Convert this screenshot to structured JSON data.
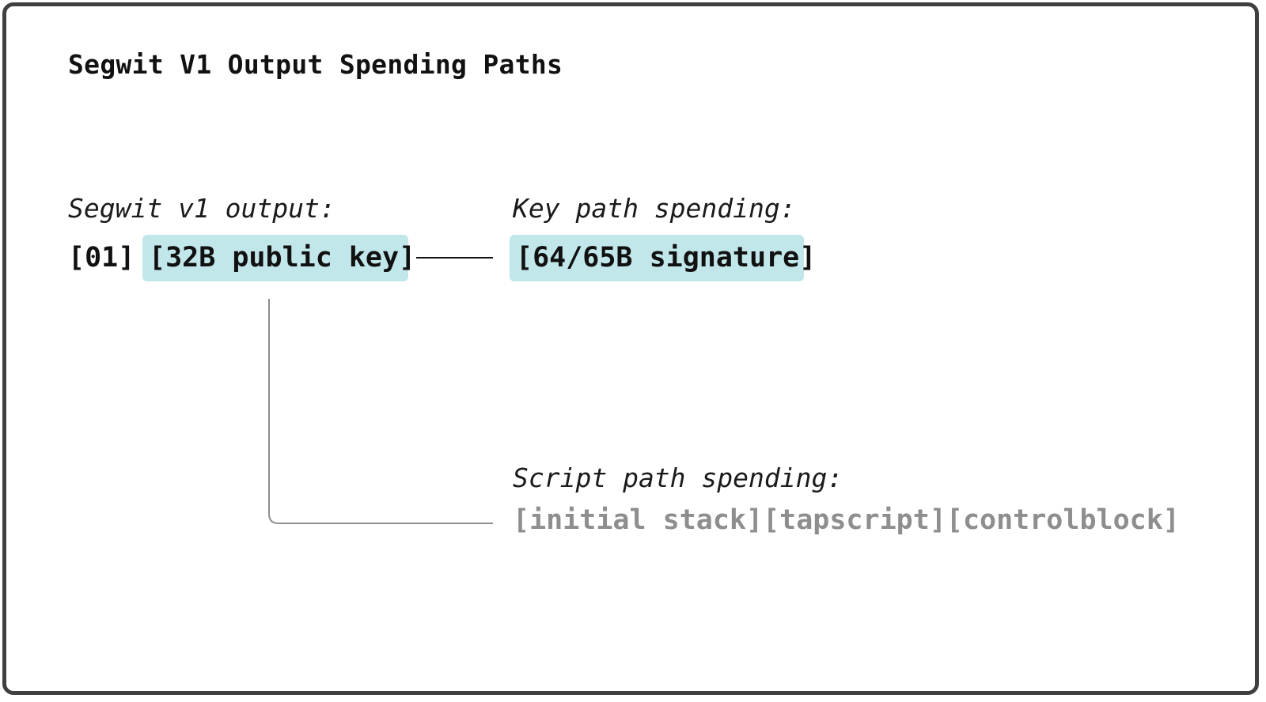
{
  "title": "Segwit V1 Output Spending Paths",
  "output": {
    "label": "Segwit v1 output:",
    "version": "[01]",
    "pubkey": "[32B public key]"
  },
  "key_path": {
    "label": "Key path spending:",
    "signature": "[64/65B signature]"
  },
  "script_path": {
    "label": "Script path spending:",
    "witness": "[initial stack][tapscript][controlblock]"
  },
  "colors": {
    "highlight": "#c2e7ea",
    "muted_text": "#8e8e8e",
    "connector_key": "#111111",
    "connector_script": "#8e8e8e"
  }
}
